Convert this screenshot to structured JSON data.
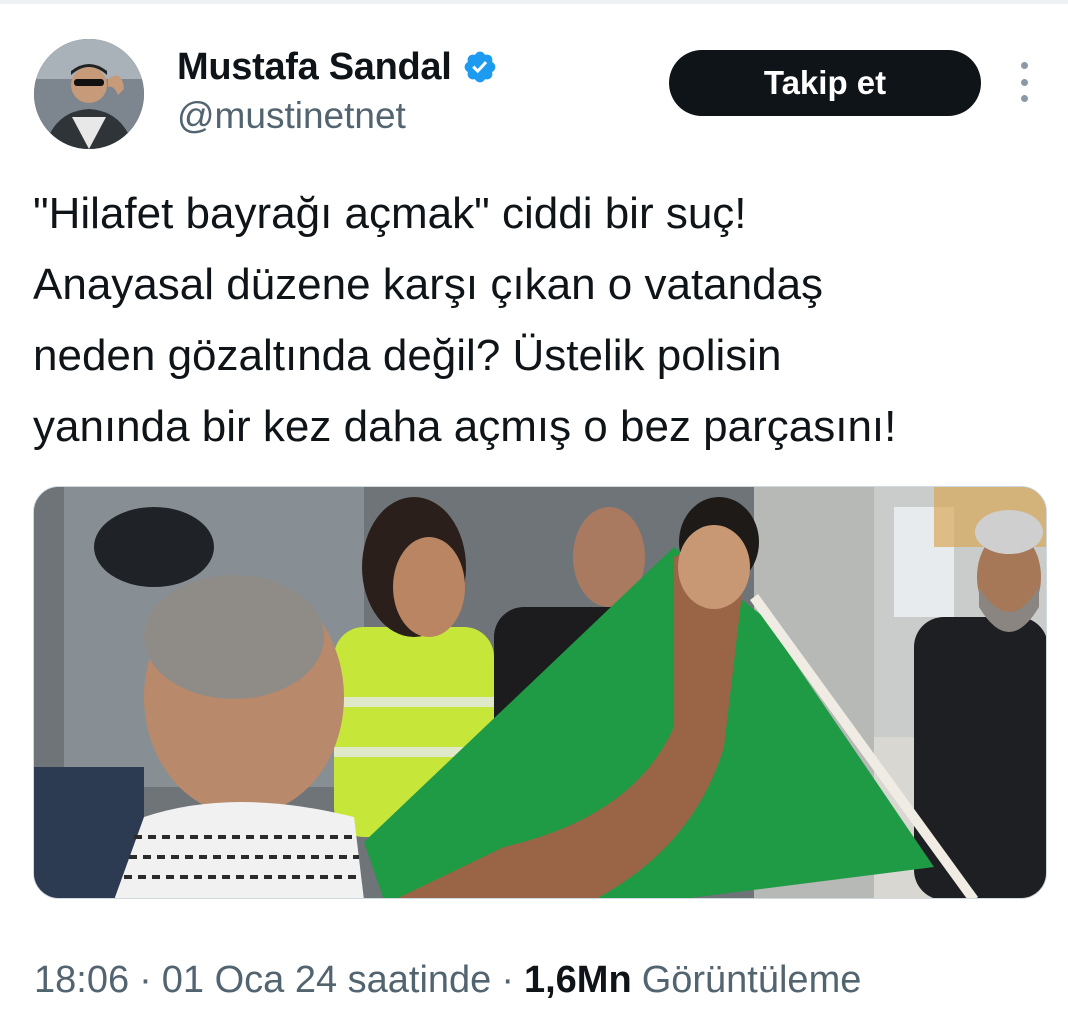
{
  "author": {
    "display_name": "Mustafa Sandal",
    "handle": "@mustinetnet",
    "verified_icon": "verified-badge-icon",
    "verified_color": "#1d9bf0"
  },
  "actions": {
    "follow_label": "Takip et",
    "more_icon": "more-vertical-icon"
  },
  "tweet": {
    "text_lines": [
      "\"Hilafet bayrağı açmak\" ciddi bir suç!",
      "Anayasal düzene karşı çıkan o vatandaş",
      "neden gözaltında değil? Üstelik polisin",
      "yanında bir kez daha açmış o bez parçasını!"
    ]
  },
  "meta": {
    "time": "18:06",
    "date": "01 Oca 24 saatinde",
    "separator": "·",
    "views_count": "1,6Mn",
    "views_label": "Görüntüleme"
  },
  "colors": {
    "text_primary": "#0f1419",
    "text_secondary": "#536471",
    "button_bg": "#0f1419",
    "flag_green": "#1f9a45"
  }
}
